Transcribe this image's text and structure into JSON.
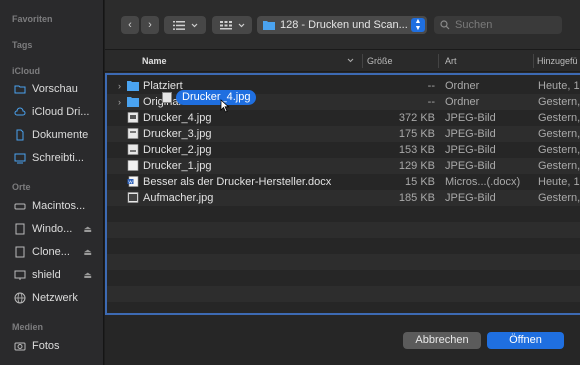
{
  "sidebar": {
    "favorites_header": "Favoriten",
    "tags_header": "Tags",
    "icloud_header": "iCloud",
    "icloud_items": [
      {
        "label": "Vorschau",
        "icon": "preview-folder-icon"
      },
      {
        "label": "iCloud Dri...",
        "icon": "cloud-icon"
      },
      {
        "label": "Dokumente",
        "icon": "document-icon"
      },
      {
        "label": "Schreibti...",
        "icon": "desktop-icon"
      }
    ],
    "locations_header": "Orte",
    "location_items": [
      {
        "label": "Macintos...",
        "icon": "harddisk-icon",
        "eject": false
      },
      {
        "label": "Windo...",
        "icon": "disk-icon",
        "eject": true
      },
      {
        "label": "Clone...",
        "icon": "disk-icon",
        "eject": true
      },
      {
        "label": "shield",
        "icon": "display-icon",
        "eject": true
      },
      {
        "label": "Netzwerk",
        "icon": "network-globe-icon",
        "eject": false
      }
    ],
    "media_header": "Medien",
    "media_items": [
      {
        "label": "Fotos",
        "icon": "camera-icon"
      }
    ]
  },
  "toolbar": {
    "back": "‹",
    "forward": "›",
    "list_view_icon": "list-view-icon",
    "grid_view_icon": "grid-view-icon",
    "path_label": "128 - Drucken und Scan...",
    "search_placeholder": "Suchen"
  },
  "columns": {
    "name": "Name",
    "size": "Größe",
    "kind": "Art",
    "date": "Hinzugefü"
  },
  "files": [
    {
      "name": "Platziert",
      "size": "--",
      "kind": "Ordner",
      "date": "Heute, 1",
      "type": "folder",
      "expandable": true
    },
    {
      "name": "Original",
      "size": "--",
      "kind": "Ordner",
      "date": "Gestern,",
      "type": "folder",
      "expandable": true
    },
    {
      "name": "Drucker_4.jpg",
      "size": "372 KB",
      "kind": "JPEG-Bild",
      "date": "Gestern,",
      "type": "jpg",
      "expandable": false
    },
    {
      "name": "Drucker_3.jpg",
      "size": "175 KB",
      "kind": "JPEG-Bild",
      "date": "Gestern,",
      "type": "jpg",
      "expandable": false
    },
    {
      "name": "Drucker_2.jpg",
      "size": "153 KB",
      "kind": "JPEG-Bild",
      "date": "Gestern,",
      "type": "jpg",
      "expandable": false
    },
    {
      "name": "Drucker_1.jpg",
      "size": "129 KB",
      "kind": "JPEG-Bild",
      "date": "Gestern,",
      "type": "jpg",
      "expandable": false
    },
    {
      "name": "Besser als der Drucker-Hersteller.docx",
      "size": "15 KB",
      "kind": "Micros...(.docx)",
      "date": "Heute, 1",
      "type": "docx",
      "expandable": false
    },
    {
      "name": "Aufmacher.jpg",
      "size": "185 KB",
      "kind": "JPEG-Bild",
      "date": "Gestern,",
      "type": "jpg",
      "expandable": false
    }
  ],
  "drag": {
    "label": "Drucker_4.jpg"
  },
  "footer": {
    "cancel": "Abbrechen",
    "open": "Öffnen"
  },
  "colors": {
    "accent": "#1f6fe0",
    "folder": "#4aa3f0",
    "list_border": "#3d6ab3"
  }
}
